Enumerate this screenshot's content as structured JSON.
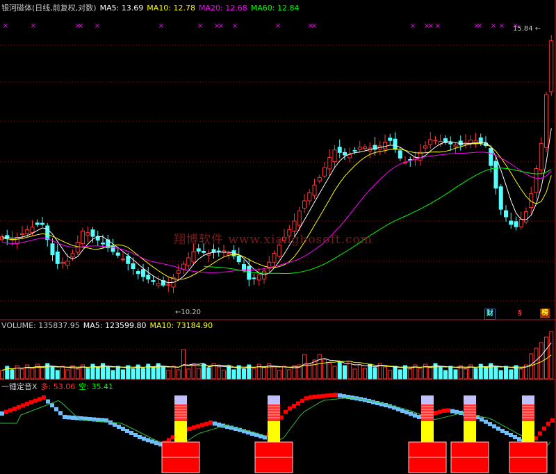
{
  "main_header": {
    "title": "银河磁体(日线,前复权,对数)",
    "ma5": "MA5: 13.69",
    "ma10": "MA10: 12.78",
    "ma20": "MA20: 12.68",
    "ma60": "MA60: 12.84"
  },
  "volume_header": {
    "label": "VOLUME: 135837.95",
    "ma5": "MA5: 123599.80",
    "ma10": "MA10: 73184.90"
  },
  "indicator_header": {
    "name": "一锤定音X",
    "duo": "多: 53.06",
    "kong": "空: 35.41"
  },
  "watermark": "翔博软件 www.xiangbosoft.com",
  "tags": {
    "cai": "财",
    "tag2": "§",
    "bang": "榜"
  },
  "colors": {
    "ma5": "#ffffff",
    "ma10": "#ffff00",
    "ma20": "#ff00ff",
    "ma60": "#00ff00",
    "up": "#ff3232",
    "down": "#54ffff",
    "duo": "#ff0000",
    "kong": "#70c0ff",
    "x_marker": "#ff00ff"
  },
  "chart_data": [
    {
      "type": "candlestick",
      "title": "银河磁体(日线,前复权,对数)",
      "log_scale": true,
      "annotations": [
        {
          "text": "15.84",
          "kind": "high"
        },
        {
          "text": "10.20",
          "kind": "low"
        }
      ],
      "series": [
        {
          "name": "MA5",
          "last": 13.69
        },
        {
          "name": "MA10",
          "last": 12.78
        },
        {
          "name": "MA20",
          "last": 12.68
        },
        {
          "name": "MA60",
          "last": 12.84
        }
      ],
      "x_markers": "magenta × signals along the top"
    },
    {
      "type": "bar",
      "title": "VOLUME",
      "last_value": 135837.95,
      "series": [
        {
          "name": "MA5",
          "last": 123599.8
        },
        {
          "name": "MA10",
          "last": 73184.9
        }
      ]
    },
    {
      "type": "line",
      "title": "一锤定音X",
      "series": [
        {
          "name": "多",
          "last": 53.06
        },
        {
          "name": "空",
          "last": 35.41
        }
      ]
    }
  ]
}
